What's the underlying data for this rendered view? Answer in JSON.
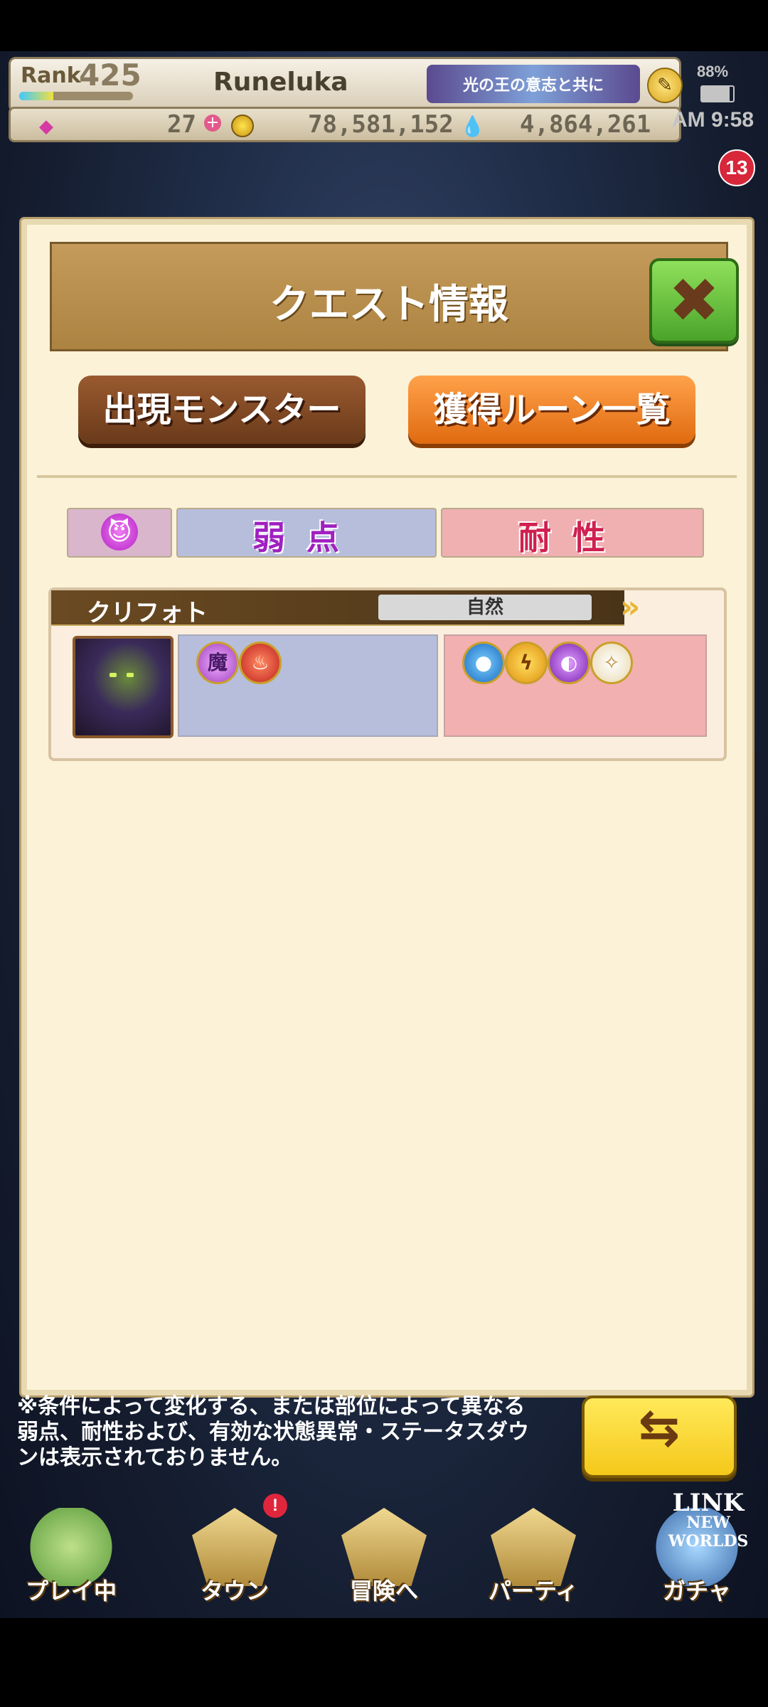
{
  "header": {
    "rank_label": "Rank",
    "rank_value": "425",
    "player_name": "Runeluka",
    "banner_text": "光の王の意志と共に",
    "gems": "27",
    "gold": "78,581,152",
    "souls": "4,864,261"
  },
  "status": {
    "battery": "88%",
    "time": "AM 9:58"
  },
  "gift_count": "13",
  "modal": {
    "title": "クエスト情報",
    "tab_monsters": "出現モンスター",
    "tab_runes": "獲得ルーン一覧",
    "col_weak": "弱点",
    "col_resist": "耐性"
  },
  "monster": {
    "name": "クリフォト",
    "attribute": "自然",
    "weak": [
      {
        "icon": "demon-icon",
        "glyph": "魔"
      },
      {
        "icon": "fire-icon",
        "glyph": "♨"
      }
    ],
    "resist": [
      {
        "icon": "water-icon",
        "glyph": "●"
      },
      {
        "icon": "thunder-icon",
        "glyph": "ϟ"
      },
      {
        "icon": "dark-icon",
        "glyph": "◐"
      },
      {
        "icon": "light-icon",
        "glyph": "✧"
      }
    ]
  },
  "note": "※条件によって変化する、または部位によって異なる弱点、耐性および、有効な状態異常・ステータスダウンは表示されておりません。",
  "nav": {
    "play": "プレイ中",
    "town": "タウン",
    "adventure": "冒険へ",
    "party": "パーティ",
    "gacha": "ガチャ",
    "town_badge": "!"
  },
  "logo": {
    "line1": "LINK",
    "line2": "NEW WORLDS"
  }
}
